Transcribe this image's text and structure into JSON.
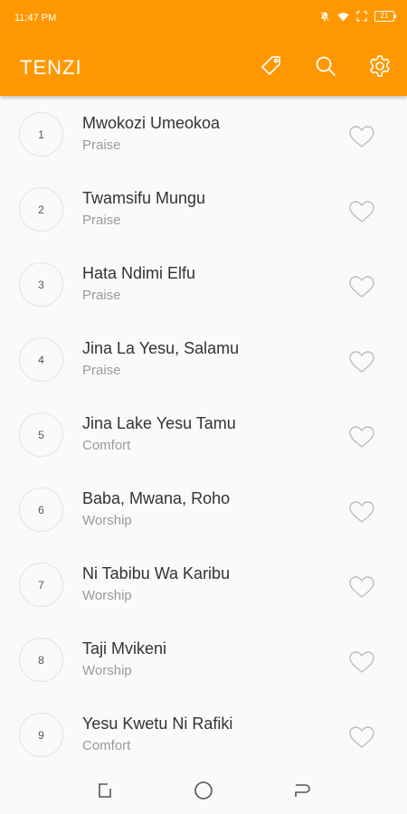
{
  "status_bar": {
    "time": "11:47 PM",
    "battery": "21"
  },
  "app_bar": {
    "title": "TENZI",
    "accent_color": "#ff9800"
  },
  "toolbar": {
    "icons": [
      "tag-icon",
      "search-icon",
      "gear-icon"
    ]
  },
  "songs": [
    {
      "number": "1",
      "title": "Mwokozi Umeokoa",
      "category": "Praise"
    },
    {
      "number": "2",
      "title": "Twamsifu Mungu",
      "category": "Praise"
    },
    {
      "number": "3",
      "title": "Hata Ndimi Elfu",
      "category": "Praise"
    },
    {
      "number": "4",
      "title": "Jina La Yesu, Salamu",
      "category": "Praise"
    },
    {
      "number": "5",
      "title": "Jina Lake Yesu Tamu",
      "category": "Comfort"
    },
    {
      "number": "6",
      "title": "Baba, Mwana, Roho",
      "category": "Worship"
    },
    {
      "number": "7",
      "title": "Ni Tabibu Wa Karibu",
      "category": "Worship"
    },
    {
      "number": "8",
      "title": "Taji Mvikeni",
      "category": "Worship"
    },
    {
      "number": "9",
      "title": "Yesu Kwetu Ni Rafiki",
      "category": "Comfort"
    }
  ]
}
